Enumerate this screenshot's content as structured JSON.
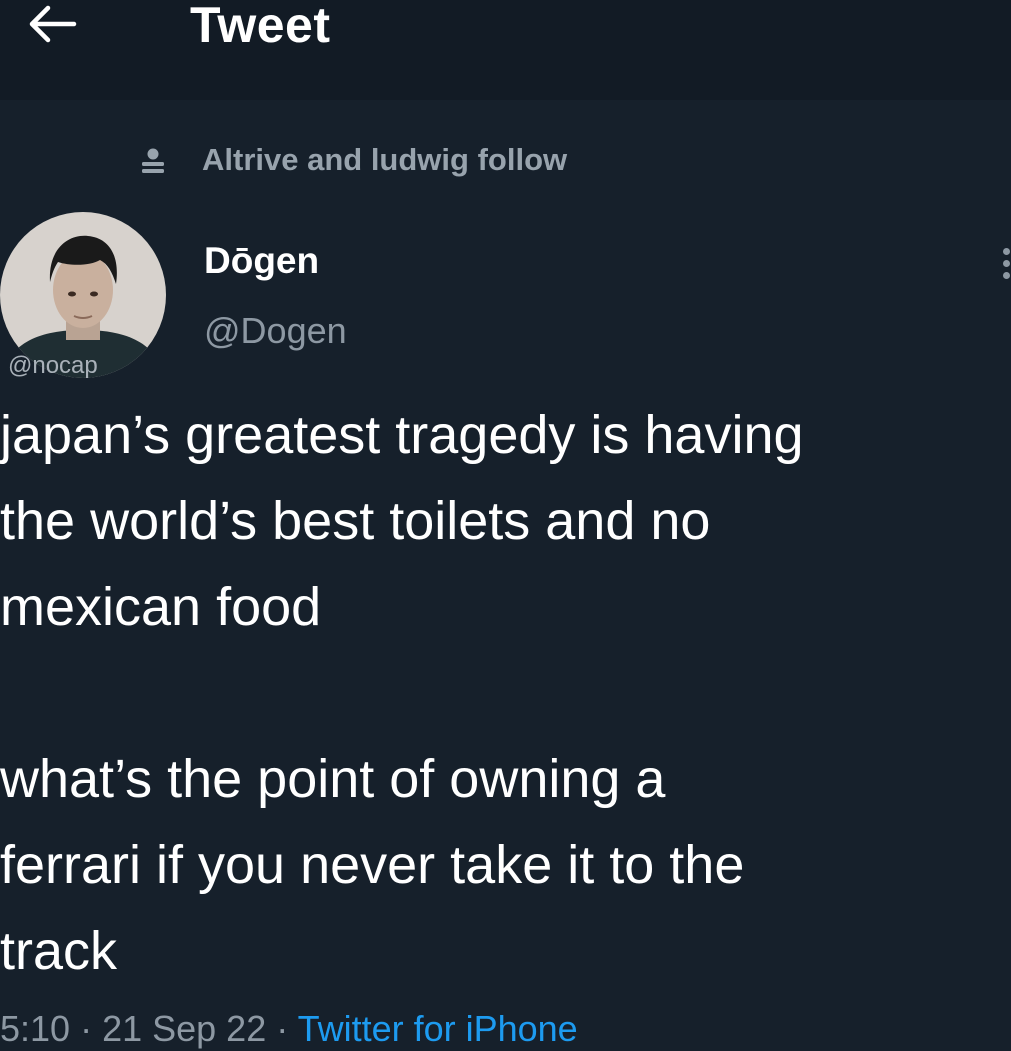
{
  "header": {
    "title": "Tweet"
  },
  "social_context": {
    "text": "Altrive and ludwig follow"
  },
  "watermark": "@nocap",
  "author": {
    "display_name": "Dōgen",
    "handle": "@Dogen"
  },
  "tweet": {
    "paragraphs": [
      [
        "japan’s greatest tragedy is having",
        "the world’s best toilets and no",
        "mexican food"
      ],
      [
        "what’s the point of owning a",
        "ferrari if you never take it to the",
        "track"
      ]
    ]
  },
  "meta": {
    "time": "5:10",
    "separator": " · ",
    "date": "21 Sep 22",
    "source": "Twitter for iPhone"
  },
  "colors": {
    "background": "#16202b",
    "header_background": "#121b25",
    "secondary_text": "#8d98a3",
    "link": "#1d9bf0"
  },
  "icons": {
    "back": "arrow-left-icon",
    "social": "person-icon",
    "more": "more-vertical-icon"
  }
}
